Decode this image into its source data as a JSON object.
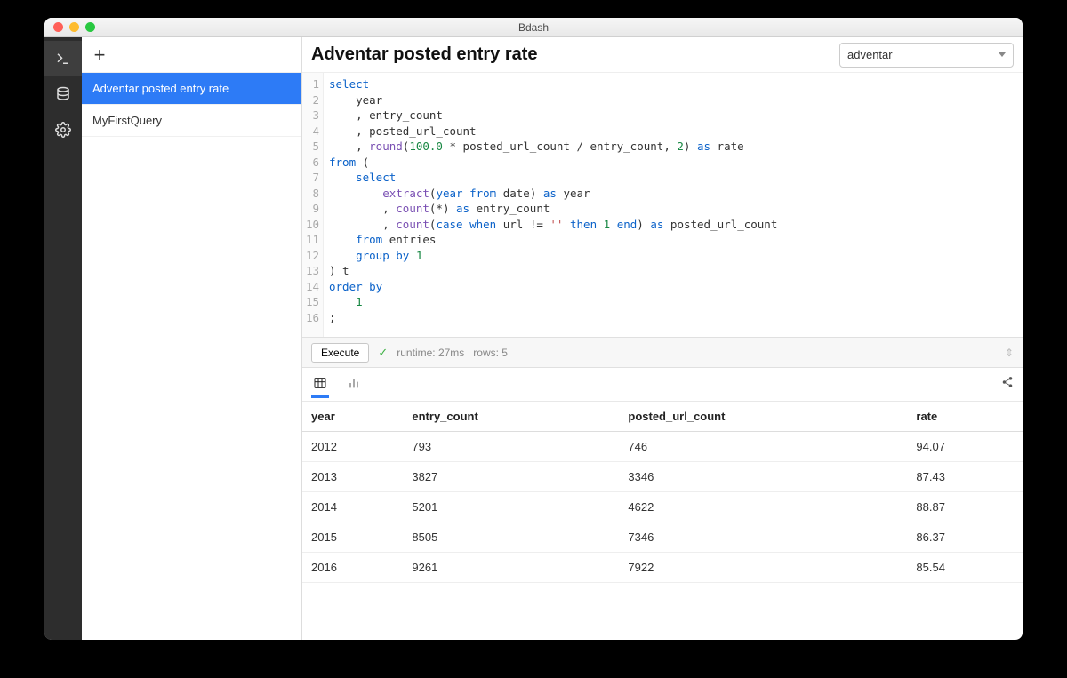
{
  "window": {
    "title": "Bdash"
  },
  "sidebar": {
    "queries": [
      {
        "label": "Adventar posted entry rate",
        "selected": true
      },
      {
        "label": "MyFirstQuery",
        "selected": false
      }
    ]
  },
  "header": {
    "query_title": "Adventar posted entry rate",
    "datasource": "adventar"
  },
  "editor": {
    "line_count": 16,
    "sql_tokens": [
      [
        {
          "t": "select",
          "c": "kw"
        }
      ],
      [
        {
          "t": "    year"
        }
      ],
      [
        {
          "t": "    , entry_count"
        }
      ],
      [
        {
          "t": "    , posted_url_count"
        }
      ],
      [
        {
          "t": "    , "
        },
        {
          "t": "round",
          "c": "fn"
        },
        {
          "t": "("
        },
        {
          "t": "100.0",
          "c": "num"
        },
        {
          "t": " * posted_url_count / entry_count, "
        },
        {
          "t": "2",
          "c": "num"
        },
        {
          "t": ") "
        },
        {
          "t": "as",
          "c": "kw"
        },
        {
          "t": " rate"
        }
      ],
      [
        {
          "t": "from",
          "c": "kw"
        },
        {
          "t": " ("
        }
      ],
      [
        {
          "t": "    "
        },
        {
          "t": "select",
          "c": "kw"
        }
      ],
      [
        {
          "t": "        "
        },
        {
          "t": "extract",
          "c": "fn"
        },
        {
          "t": "("
        },
        {
          "t": "year",
          "c": "kw"
        },
        {
          "t": " "
        },
        {
          "t": "from",
          "c": "kw"
        },
        {
          "t": " date) "
        },
        {
          "t": "as",
          "c": "kw"
        },
        {
          "t": " year"
        }
      ],
      [
        {
          "t": "        , "
        },
        {
          "t": "count",
          "c": "fn"
        },
        {
          "t": "(*) "
        },
        {
          "t": "as",
          "c": "kw"
        },
        {
          "t": " entry_count"
        }
      ],
      [
        {
          "t": "        , "
        },
        {
          "t": "count",
          "c": "fn"
        },
        {
          "t": "("
        },
        {
          "t": "case",
          "c": "kw"
        },
        {
          "t": " "
        },
        {
          "t": "when",
          "c": "kw"
        },
        {
          "t": " url != "
        },
        {
          "t": "''",
          "c": "str"
        },
        {
          "t": " "
        },
        {
          "t": "then",
          "c": "kw"
        },
        {
          "t": " "
        },
        {
          "t": "1",
          "c": "num"
        },
        {
          "t": " "
        },
        {
          "t": "end",
          "c": "kw"
        },
        {
          "t": ") "
        },
        {
          "t": "as",
          "c": "kw"
        },
        {
          "t": " posted_url_count"
        }
      ],
      [
        {
          "t": "    "
        },
        {
          "t": "from",
          "c": "kw"
        },
        {
          "t": " entries"
        }
      ],
      [
        {
          "t": "    "
        },
        {
          "t": "group by",
          "c": "kw"
        },
        {
          "t": " "
        },
        {
          "t": "1",
          "c": "num"
        }
      ],
      [
        {
          "t": ") t"
        }
      ],
      [
        {
          "t": "order by",
          "c": "kw"
        }
      ],
      [
        {
          "t": "    "
        },
        {
          "t": "1",
          "c": "num"
        }
      ],
      [
        {
          "t": ";"
        }
      ]
    ]
  },
  "execute": {
    "button_label": "Execute",
    "runtime_label": "runtime: 27ms",
    "rows_label": "rows: 5"
  },
  "results": {
    "columns": [
      "year",
      "entry_count",
      "posted_url_count",
      "rate"
    ],
    "rows": [
      [
        "2012",
        "793",
        "746",
        "94.07"
      ],
      [
        "2013",
        "3827",
        "3346",
        "87.43"
      ],
      [
        "2014",
        "5201",
        "4622",
        "88.87"
      ],
      [
        "2015",
        "8505",
        "7346",
        "86.37"
      ],
      [
        "2016",
        "9261",
        "7922",
        "85.54"
      ]
    ]
  }
}
